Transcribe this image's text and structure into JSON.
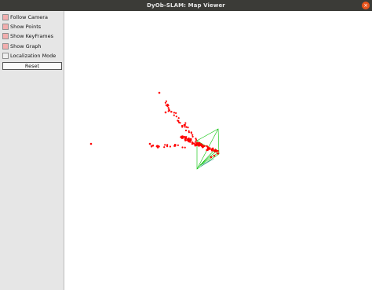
{
  "window": {
    "title": "DyOb-SLAM: Map Viewer",
    "close_glyph": "×"
  },
  "panel": {
    "options": [
      {
        "label": "Follow Camera",
        "checked": true
      },
      {
        "label": "Show Points",
        "checked": true
      },
      {
        "label": "Show KeyFrames",
        "checked": true
      },
      {
        "label": "Show Graph",
        "checked": true
      },
      {
        "label": "Localization Mode",
        "checked": false
      }
    ],
    "reset_label": "Reset"
  },
  "colors": {
    "map_points": "#ff0000",
    "camera_frustum": "#00c000",
    "graph_edges": "#55aaaa",
    "checkbox_on": "#f2aeae"
  }
}
